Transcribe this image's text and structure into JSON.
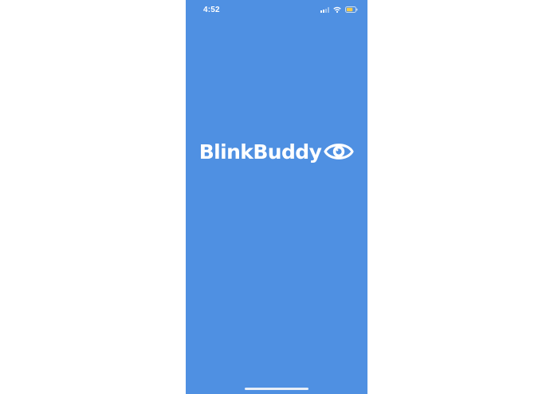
{
  "status_bar": {
    "time": "4:52",
    "icons": [
      "cellular-signal-icon",
      "wifi-icon",
      "battery-icon"
    ],
    "battery_color": "#f2c94c"
  },
  "splash": {
    "app_name": "BlinkBuddy",
    "logo_icon": "eye-icon",
    "background_color": "#4f90e2",
    "text_color": "#ffffff"
  },
  "home_indicator": {
    "icon": "home-indicator"
  }
}
